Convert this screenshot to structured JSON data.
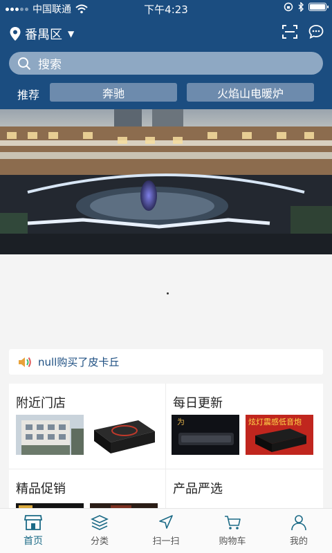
{
  "status_bar": {
    "carrier": "中国联通",
    "time": "下午4:23",
    "battery_level": 0.92
  },
  "header": {
    "location": "番禺区",
    "search_placeholder": "搜索",
    "recommend_label": "推荐",
    "recommend_chips": [
      "奔驰",
      "火焰山电暖炉"
    ]
  },
  "news": {
    "text": "null购买了皮卡丘"
  },
  "sections": [
    {
      "title": "附近门店"
    },
    {
      "title": "每日更新",
      "thumb_caption": "炫灯震感低音炮"
    },
    {
      "title": "精品促销"
    },
    {
      "title": "产品严选"
    }
  ],
  "tabbar": {
    "tabs": [
      {
        "label": "首页",
        "icon": "store-icon",
        "active": true
      },
      {
        "label": "分类",
        "icon": "layers-icon",
        "active": false
      },
      {
        "label": "扫一扫",
        "icon": "navigation-arrow-icon",
        "active": false
      },
      {
        "label": "购物车",
        "icon": "cart-icon",
        "active": false
      },
      {
        "label": "我的",
        "icon": "user-icon",
        "active": false
      }
    ]
  },
  "colors": {
    "header_bg": "#1b4d80",
    "search_bg": "#8ea8c3",
    "chip_bg": "#6d8bad",
    "active_tab": "#1b6a86"
  }
}
